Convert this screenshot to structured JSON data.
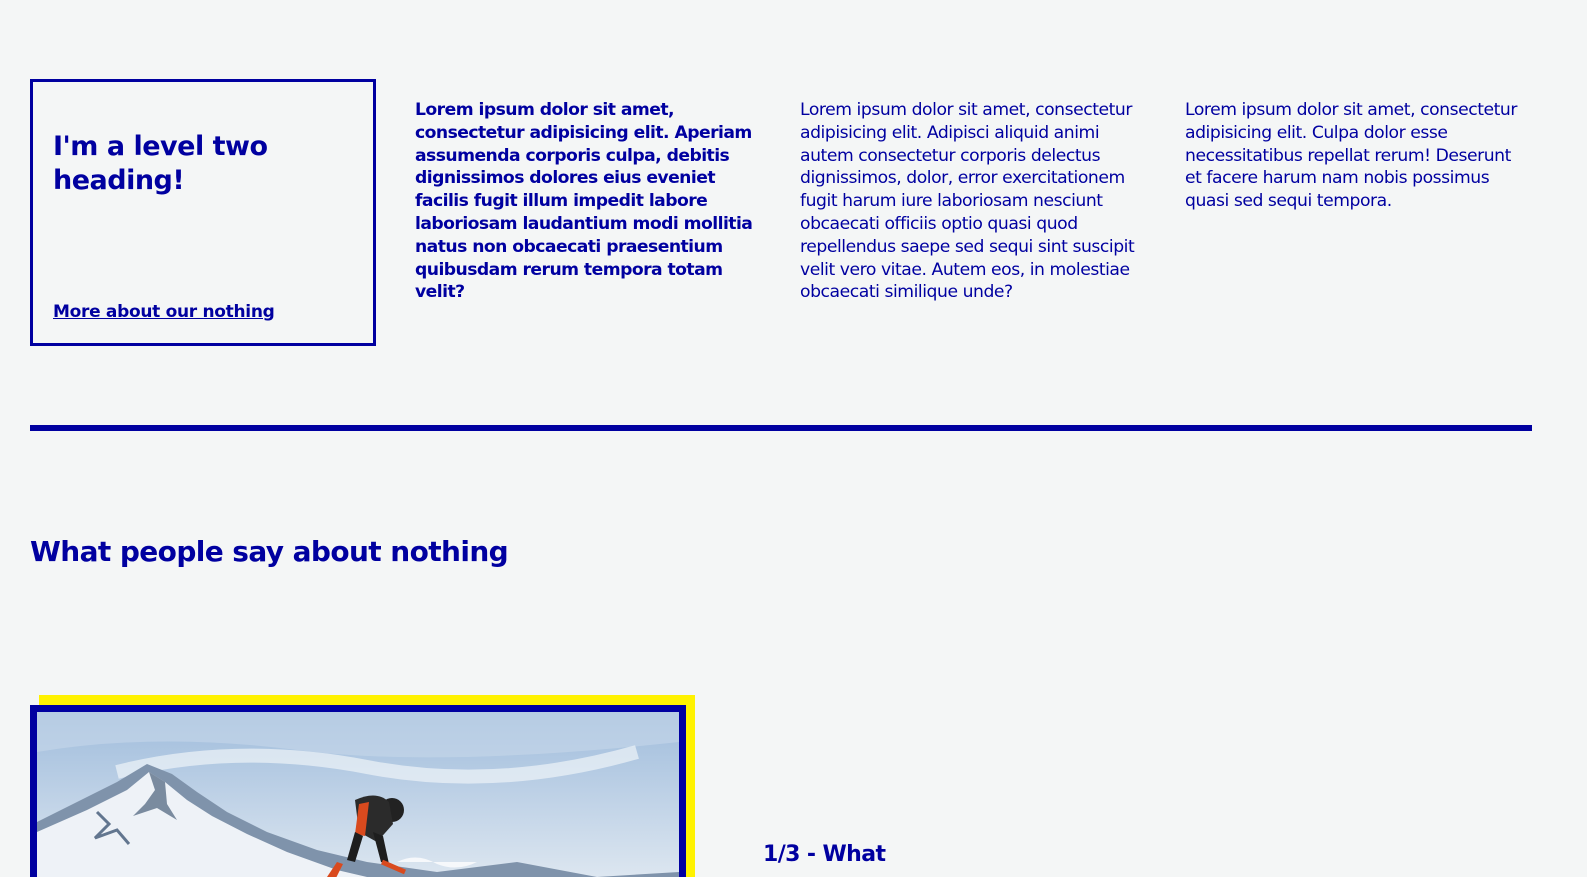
{
  "feature": {
    "heading": "I'm a level two heading!",
    "link_label": "More about our nothing"
  },
  "columns": [
    {
      "text": "Lorem ipsum dolor sit amet, consectetur adipisicing elit. Aperiam assumenda corporis culpa, debitis dignissimos dolores eius eveniet facilis fugit illum impedit labore laboriosam laudantium modi mollitia natus non obcaecati praesentium quibusdam rerum tempora totam velit?"
    },
    {
      "text": "Lorem ipsum dolor sit amet, consectetur adipisicing elit. Adipisci aliquid animi autem consectetur corporis delectus dignissimos, dolor, error exercitationem fugit harum iure laboriosam nesciunt obcaecati officiis optio quasi quod repellendus saepe sed sequi sint suscipit velit vero vitae. Autem eos, in molestiae obcaecati similique unde?"
    },
    {
      "text": "Lorem ipsum dolor sit amet, consectetur adipisicing elit. Culpa dolor esse necessitatibus repellat rerum! Deserunt et facere harum nam nobis possimus quasi sed sequi tempora."
    }
  ],
  "testimonials": {
    "title": "What people say about nothing",
    "counter": "1/3 - What",
    "image_subject": "skier-jumping-mountain-photo"
  },
  "colors": {
    "primary": "#0000a0",
    "accent": "#fff200",
    "background": "#f4f6f6"
  }
}
